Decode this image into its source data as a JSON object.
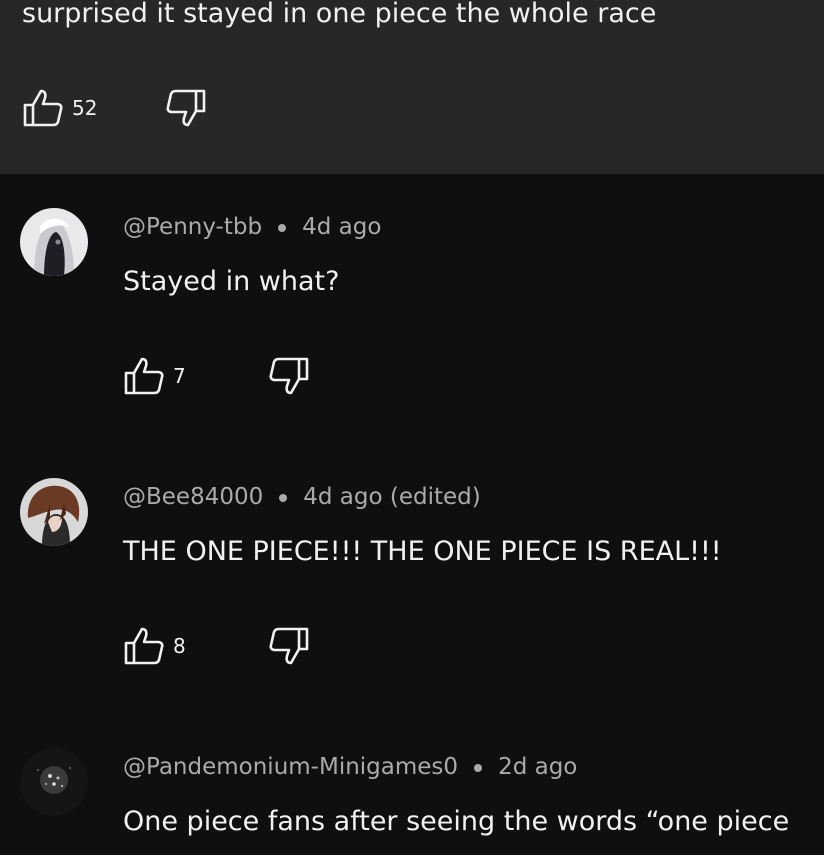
{
  "top_comment": {
    "text": "surprised it stayed in one piece the whole race",
    "likes": "52"
  },
  "comments": [
    {
      "author": "@Penny-tbb",
      "time": "4d ago",
      "text": "Stayed in what?",
      "likes": "7",
      "avatar_icon": "avatar-white-hair"
    },
    {
      "author": "@Bee84000",
      "time": "4d ago (edited)",
      "text": "THE ONE PIECE!!! THE ONE PIECE IS REAL!!!",
      "likes": "8",
      "avatar_icon": "avatar-brown-hair"
    },
    {
      "author": "@Pandemonium-Minigames0",
      "time": "2d ago",
      "text": "One piece fans after seeing the words “one piece",
      "avatar_icon": "avatar-dark-space"
    }
  ],
  "colors": {
    "background": "#0f0f0f",
    "top_panel": "#272727",
    "meta_text": "#aaaaaa",
    "text": "#f1f1f1"
  }
}
